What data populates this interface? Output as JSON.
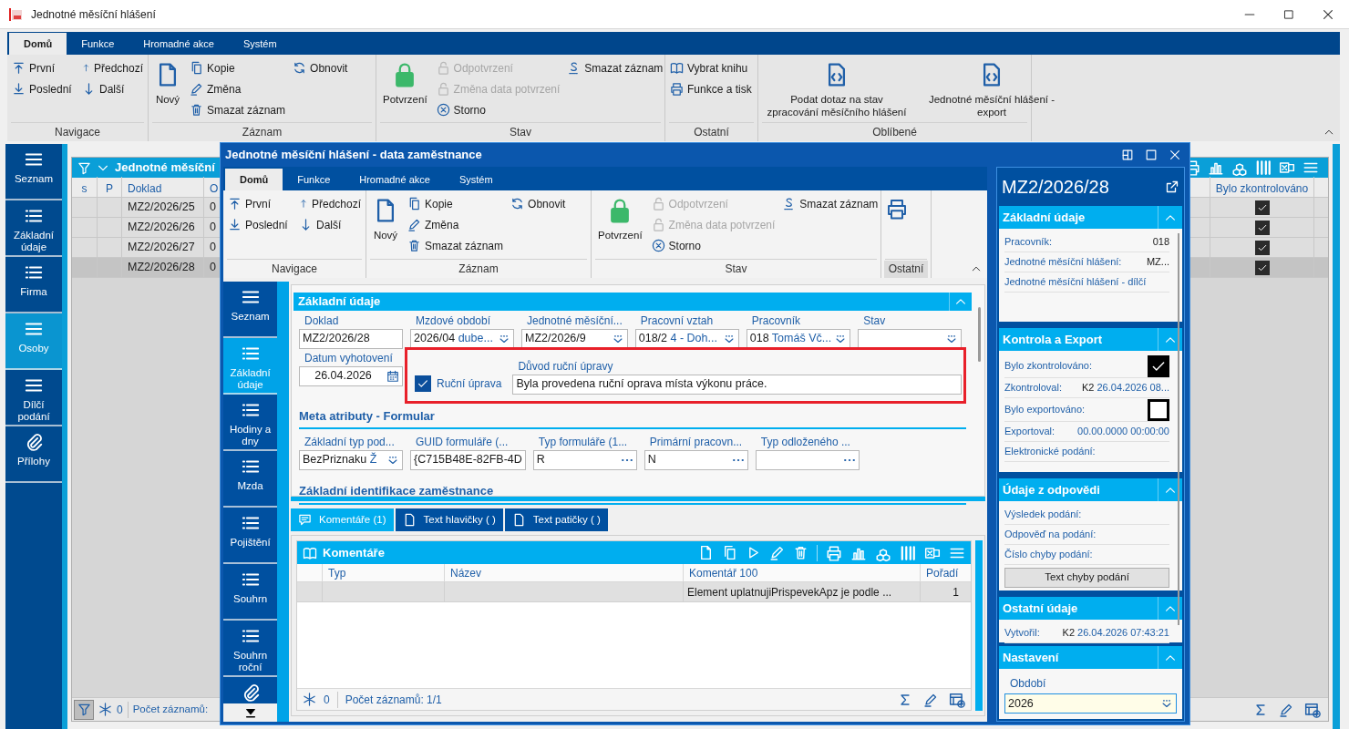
{
  "window": {
    "title": "Jednotné měsíční hlášení"
  },
  "ribbon": {
    "tabs": [
      {
        "label": "Domů",
        "selected": true
      },
      {
        "label": "Funkce",
        "selected": false
      },
      {
        "label": "Hromadné akce",
        "selected": false
      },
      {
        "label": "Systém",
        "selected": false
      }
    ],
    "groups": [
      {
        "label": "Navigace",
        "items": [
          "První",
          "Předchozí",
          "Poslední",
          "Další"
        ]
      },
      {
        "label": "Záznam",
        "items": [
          "Nový",
          "Kopie",
          "Změna",
          "Smazat záznam",
          "Obnovit"
        ]
      },
      {
        "label": "Stav",
        "items": [
          {
            "label": "Potvrzení",
            "disabled": false
          },
          {
            "label": "Odpotvrzení",
            "disabled": true
          },
          {
            "label": "Změna data potvrzení",
            "disabled": true
          },
          {
            "label": "Storno",
            "disabled": false
          },
          {
            "label": "Smazat záznam",
            "disabled": false
          }
        ]
      },
      {
        "label": "Ostatní",
        "items": [
          "Vybrat knihu",
          "Funkce a tisk"
        ]
      },
      {
        "label": "Oblíbené",
        "items": [
          "Podat dotaz na stav zpracování měsíčního hlášení",
          "Jednotné měsíční hlášení - export"
        ]
      }
    ]
  },
  "navigator": {
    "items": [
      {
        "label": "Seznam",
        "kind": "menu",
        "selected": false
      },
      {
        "label": "Základní údaje",
        "kind": "bullets",
        "selected": false
      },
      {
        "label": "Firma",
        "kind": "bullets",
        "selected": false
      },
      {
        "label": "Osoby",
        "kind": "menu",
        "selected": true
      },
      {
        "label": "Dílčí podání",
        "kind": "menu",
        "selected": false
      },
      {
        "label": "Přílohy",
        "kind": "attachment",
        "selected": false
      }
    ]
  },
  "list": {
    "title": "Jednotné měsíční",
    "columns": [
      "s",
      "P",
      "Doklad",
      "O",
      "Bylo zkontrolováno"
    ],
    "rows": [
      {
        "doklad": "MZ2/2026/25",
        "column_4": "0",
        "checked": true,
        "selected": false
      },
      {
        "doklad": "MZ2/2026/26",
        "column_4": "0",
        "checked": true,
        "selected": false
      },
      {
        "doklad": "MZ2/2026/27",
        "column_4": "0",
        "checked": true,
        "selected": false
      },
      {
        "doklad": "MZ2/2026/28",
        "column_4": "0",
        "checked": true,
        "selected": true
      }
    ],
    "status": {
      "count": "0",
      "records": "Počet záznamů:"
    }
  },
  "dialog": {
    "title": "Jednotné měsíční hlášení - data zaměstnance",
    "ribbon": {
      "tabs": [
        {
          "label": "Domů",
          "selected": true
        },
        {
          "label": "Funkce",
          "selected": false
        },
        {
          "label": "Hromadné akce",
          "selected": false
        },
        {
          "label": "Systém",
          "selected": false
        }
      ],
      "groups": [
        {
          "label": "Navigace",
          "highlighted": false,
          "items": [
            "První",
            "Předchozí",
            "Poslední",
            "Další"
          ]
        },
        {
          "label": "Záznam",
          "highlighted": false,
          "items": [
            "Nový",
            "Kopie",
            "Změna",
            "Smazat záznam",
            "Obnovit"
          ]
        },
        {
          "label": "Stav",
          "highlighted": false,
          "items": [
            {
              "label": "Potvrzení",
              "disabled": false
            },
            {
              "label": "Odpotvrzení",
              "disabled": true
            },
            {
              "label": "Změna data potvrzení",
              "disabled": true
            },
            {
              "label": "Storno",
              "disabled": false
            },
            {
              "label": "Smazat záznam",
              "disabled": false
            }
          ]
        },
        {
          "label": "Ostatní",
          "highlighted": true
        }
      ]
    },
    "navigator": {
      "items": [
        {
          "label": "Seznam",
          "kind": "menu",
          "selected": false
        },
        {
          "label": "Základní údaje",
          "kind": "bullets",
          "selected": true
        },
        {
          "label": "Hodiny a dny",
          "kind": "bullets",
          "selected": false
        },
        {
          "label": "Mzda",
          "kind": "bullets",
          "selected": false
        },
        {
          "label": "Pojištění",
          "kind": "bullets",
          "selected": false
        },
        {
          "label": "Souhrn",
          "kind": "bullets",
          "selected": false
        },
        {
          "label": "Souhrn roční",
          "kind": "bullets",
          "selected": false
        },
        {
          "kind": "attachment",
          "selected": false
        }
      ]
    },
    "form": {
      "section": "Základní údaje",
      "fields": [
        {
          "label": "Doklad",
          "value": "MZ2/2026/28",
          "kind": "text"
        },
        {
          "label": "Mzdové období",
          "value": "2026/04",
          "detail": "dube...",
          "kind": "select"
        },
        {
          "label": "Jednotné měsíční...",
          "value": "MZ2/2026/9",
          "kind": "select"
        },
        {
          "label": "Pracovní vztah",
          "value": "018/2",
          "detail": "4 - Doh...",
          "kind": "select"
        },
        {
          "label": "Pracovník",
          "value": "018",
          "detail": "Tomáš Vč...",
          "kind": "select"
        },
        {
          "label": "Stav",
          "kind": "select"
        }
      ],
      "date": {
        "label": "Datum vyhotovení",
        "value": "26.04.2026",
        "kind": "date"
      },
      "manual_edit": {
        "label": "Ruční úprava",
        "checked": true
      },
      "reason": {
        "label": "Důvod ruční úpravy",
        "value": "Byla provedena ruční oprava místa výkonu práce."
      },
      "meta_heading": "Meta atributy - Formular",
      "meta_fields": [
        {
          "label": "Základní typ pod...",
          "value": "BezPriznaku",
          "detail": "Ž",
          "kind": "select"
        },
        {
          "label": "GUID formuláře (...",
          "value": "{C715B48E-82FB-4D",
          "kind": "text"
        },
        {
          "label": "Typ formuláře (1...",
          "value": "R",
          "kind": "lookup"
        },
        {
          "label": "Primární pracovn...",
          "value": "N",
          "kind": "lookup"
        },
        {
          "label": "Typ odloženého ...",
          "kind": "lookup"
        }
      ],
      "identity_heading": "Základní identifikace zaměstnance"
    },
    "bottom_tabs": [
      {
        "label": "Komentáře (1)",
        "kind": "comments",
        "selected": true
      },
      {
        "label": "Text hlavičky ( )",
        "kind": "page",
        "selected": false
      },
      {
        "label": "Text patičky ( )",
        "kind": "page",
        "selected": false
      }
    ],
    "comments": {
      "title": "Komentáře",
      "columns": [
        "Typ",
        "Název",
        "Komentář 100",
        "Pořadí"
      ],
      "rows": [
        {
          "comment": "Element uplatnujiPrispevekApz je podle ...",
          "order": "1"
        }
      ],
      "status": {
        "count": "0",
        "records": "Počet záznamů: 1/1"
      }
    }
  },
  "detail_panel": {
    "title": "MZ2/2026/28",
    "sections": [
      {
        "title": "Základní údaje",
        "rows": [
          {
            "kind": "text",
            "label": "Pracovník:",
            "value": "018"
          },
          {
            "kind": "text",
            "label": "Jednotné měsíční hlášení:",
            "value": "MZ..."
          },
          {
            "kind": "text",
            "label": "Jednotné měsíční hlášení - dílčí"
          }
        ]
      },
      {
        "title": "Kontrola a Export",
        "rows": [
          {
            "kind": "check",
            "label": "Bylo zkontrolováno:",
            "checked": true
          },
          {
            "kind": "stamp",
            "label": "Zkontroloval:",
            "user": "K2",
            "value": "26.04.2026 08..."
          },
          {
            "kind": "check",
            "label": "Bylo exportováno:",
            "checked": false
          },
          {
            "kind": "stamp",
            "label": "Exportoval:",
            "value": "00.00.0000 00:00:00"
          },
          {
            "kind": "text",
            "label": "Elektronické podání:"
          }
        ]
      },
      {
        "title": "Údaje z odpovědi",
        "rows": [
          {
            "kind": "text",
            "label": "Výsledek podání:"
          },
          {
            "kind": "text",
            "label": "Odpověď na podání:"
          },
          {
            "kind": "text",
            "label": "Číslo chyby podání:"
          },
          {
            "kind": "button",
            "label": "Text chyby podání"
          }
        ]
      },
      {
        "title": "Ostatní údaje",
        "rows": [
          {
            "kind": "stamp",
            "label": "Vytvořil:",
            "user": "K2",
            "value": "26.04.2026 07:43:21"
          }
        ]
      }
    ],
    "settings": {
      "title": "Nastavení",
      "label": "Období",
      "value": "2026"
    }
  }
}
